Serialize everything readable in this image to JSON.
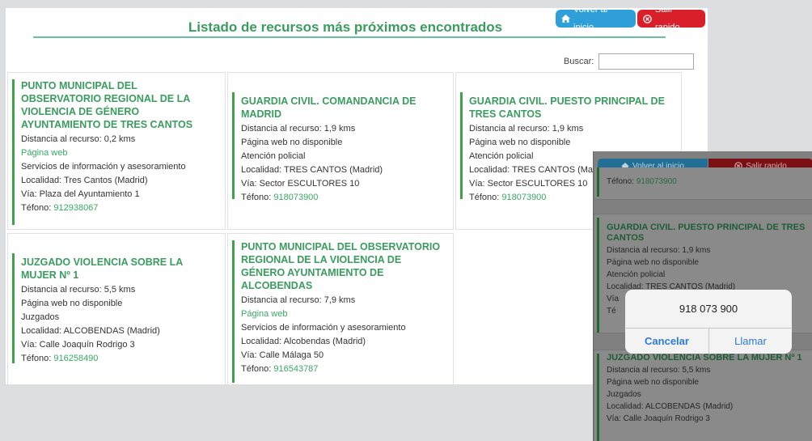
{
  "header": {
    "title": "Listado de recursos más próximos encontrados",
    "home_button": "Volver al inicio",
    "exit_button": "Salir rapido",
    "search_label": "Buscar:",
    "search_value": ""
  },
  "cards": [
    {
      "title": "PUNTO MUNICIPAL DEL OBSERVATORIO REGIONAL DE LA VIOLENCIA DE GÉNERO AYUNTAMIENTO DE TRES CANTOS",
      "distance": "Distancia al recurso: 0,2 kms",
      "web": "Página web",
      "service": "Servicios de información y asesoramiento",
      "locality": "Localidad: Tres Cantos (Madrid)",
      "street": "Vía: Plaza del Ayuntamiento 1",
      "phone_label": "Téfono: ",
      "phone": "912938067"
    },
    {
      "title": "GUARDIA CIVIL. COMANDANCIA DE MADRID",
      "distance": "Distancia al recurso: 1,9 kms",
      "web": "Página web no disponible",
      "service": "Atención policial",
      "locality": "Localidad: TRES CANTOS (Madrid)",
      "street": "Vía: Sector ESCULTORES 10",
      "phone_label": "Téfono: ",
      "phone": "918073900"
    },
    {
      "title": "GUARDIA CIVIL. PUESTO PRINCIPAL DE TRES CANTOS",
      "distance": "Distancia al recurso: 1,9 kms",
      "web": "Página web no disponible",
      "service": "Atención policial",
      "locality": "Localidad: TRES CANTOS (Ma",
      "street": "Vía: Sector ESCULTORES 10",
      "phone_label": "Téfono: ",
      "phone": "918073900"
    },
    {
      "title": "JUZGADO VIOLENCIA SOBRE LA MUJER Nº 1",
      "distance": "Distancia al recurso: 5,5 kms",
      "web": "Página web no disponible",
      "service": "Juzgados",
      "locality": "Localidad: ALCOBENDAS (Madrid)",
      "street": "Vía: Calle Joaquín Rodrigo 3",
      "phone_label": "Téfono: ",
      "phone": "916258490"
    },
    {
      "title": "PUNTO MUNICIPAL DEL OBSERVATORIO REGIONAL DE LA VIOLENCIA DE GÉNERO AYUNTAMIENTO DE ALCOBENDAS",
      "distance": "Distancia al recurso: 7,9 kms",
      "web": "Página web",
      "service": "Servicios de información y asesoramiento",
      "locality": "Localidad: Alcobendas (Madrid)",
      "street": "Vía: Calle Málaga 50",
      "phone_label": "Téfono: ",
      "phone": "916543787"
    }
  ],
  "phone_view": {
    "home_button": "Volver al inicio",
    "exit_button": "Salir rapido",
    "top_card": {
      "phone_label": "Téfono: ",
      "phone": "918073900"
    },
    "card1": {
      "title": "GUARDIA CIVIL. PUESTO PRINCIPAL DE TRES CANTOS",
      "distance": "Distancia al recurso: 1,9 kms",
      "web": "Página web no disponible",
      "service": "Atención policial",
      "locality": "Localidad: TRES CANTOS (Madrid)",
      "street": "Vía",
      "phone_label": "Té"
    },
    "card2": {
      "title": "JUZGADO VIOLENCIA SOBRE LA MUJER Nº 1",
      "distance": "Distancia al recurso: 5,5 kms",
      "web": "Página web no disponible",
      "service": "Juzgados",
      "locality": "Localidad: ALCOBENDAS (Madrid)",
      "street": "Vía: Calle Joaquín Rodrigo 3"
    },
    "dialog": {
      "message": "918 073 900",
      "cancel": "Cancelar",
      "call": "Llamar"
    }
  },
  "colors": {
    "accent_green": "#3a9c5e",
    "home_blue": "#2e9fd8",
    "exit_red": "#d9202a",
    "ios_blue": "#2b7bd9"
  }
}
